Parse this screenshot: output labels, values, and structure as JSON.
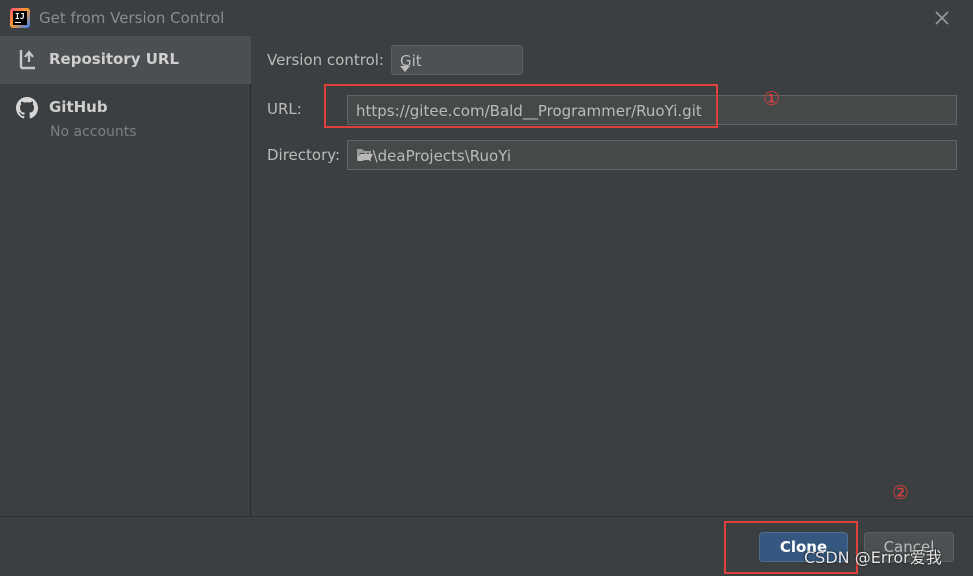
{
  "window": {
    "title": "Get from Version Control",
    "app_icon_letters": "IJ"
  },
  "sidebar": {
    "items": [
      {
        "label": "Repository URL",
        "icon": "repository-url-icon"
      },
      {
        "label": "GitHub",
        "sublabel": "No accounts",
        "icon": "github-icon"
      }
    ]
  },
  "form": {
    "version_control_label": "Version control:",
    "version_control_value": "Git",
    "url_label": "URL:",
    "url_value": "https://gitee.com/Bald__Programmer/RuoYi.git",
    "directory_label": "Directory:",
    "directory_value": "D:\\deaProjects\\RuoYi"
  },
  "annotations": {
    "step1": "①",
    "step2": "②",
    "color": "#e0403c"
  },
  "buttons": {
    "clone": "Clone",
    "cancel": "Cancel"
  },
  "watermark": "CSDN @Error爱我",
  "colors": {
    "background": "#3c3f41",
    "selected": "#4b4f52",
    "primary_button": "#365880"
  }
}
